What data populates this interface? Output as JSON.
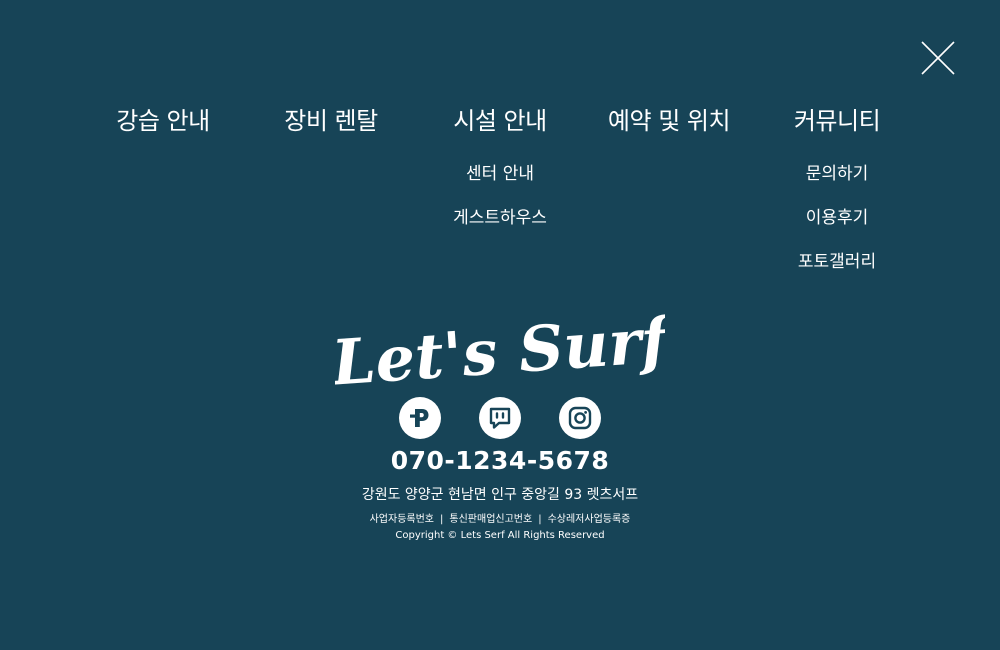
{
  "colors": {
    "background": "#174457",
    "text": "#ffffff",
    "icon_fg": "#174457"
  },
  "close": {
    "icon": "close-icon"
  },
  "nav": {
    "columns": [
      {
        "label": "강습 안내",
        "items": []
      },
      {
        "label": "장비 렌탈",
        "items": []
      },
      {
        "label": "시설 안내",
        "items": [
          "센터 안내",
          "게스트하우스"
        ]
      },
      {
        "label": "예약 및 위치",
        "items": []
      },
      {
        "label": "커뮤니티",
        "items": [
          "문의하기",
          "이용후기",
          "포토갤러리"
        ]
      }
    ]
  },
  "footer": {
    "logo_text": "Let's Surf",
    "social": [
      {
        "icon": "naver-pay-icon"
      },
      {
        "icon": "chat-icon"
      },
      {
        "icon": "instagram-icon"
      }
    ],
    "phone": "070-1234-5678",
    "address": "강원도 양양군 현남면 인구 중앙길 93 렛츠서프",
    "biz_items": [
      "사업자등록번호",
      "통신판매업신고번호",
      "수상레저사업등록증"
    ],
    "biz_separator": "|",
    "copyright": "Copyright © Lets Serf All Rights Reserved"
  }
}
